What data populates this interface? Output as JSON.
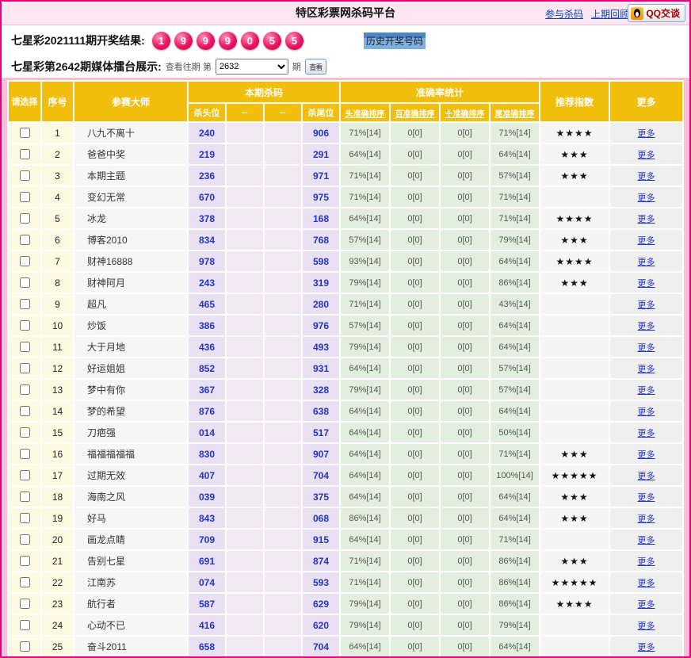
{
  "page": {
    "title": "特区彩票网杀码平台",
    "nav_links": [
      "参与杀码",
      "上期回顾"
    ],
    "qq_button": "QQ交谈"
  },
  "result": {
    "label": "七星彩2021111期开奖结果:",
    "balls": [
      "1",
      "9",
      "9",
      "9",
      "0",
      "5",
      "5"
    ],
    "history_link": "历史开奖号码"
  },
  "selector": {
    "label": "七星彩第2642期媒体擂台展示:",
    "hint": "查看往期 第",
    "period_value": "2632",
    "suffix": "期",
    "go_label": "查看"
  },
  "colors": {
    "accent_pink": "#E6007E",
    "header_gold": "#F1BE0C",
    "kill_number_blue": "#2233CC",
    "ball_red": "#EC1464"
  },
  "table": {
    "col_select": "请选择",
    "col_index": "序号",
    "col_master": "参赛大师",
    "group_kill": "本期杀码",
    "kill_subcols": [
      "杀头位",
      "--",
      "--",
      "杀尾位"
    ],
    "group_accuracy": "准确率统计",
    "accuracy_subcols": [
      "头准确排序",
      "百准确排序",
      "十准确排序",
      "尾准确排序"
    ],
    "col_stars": "推荐指数",
    "col_more": "更多",
    "more_label": "更多",
    "rows": [
      {
        "index": "1",
        "name": "八九不离十",
        "head": "240",
        "tail": "906",
        "acc": [
          "71%[14]",
          "0[0]",
          "0[0]",
          "71%[14]"
        ],
        "stars": "★★★★"
      },
      {
        "index": "2",
        "name": "爸爸中奖",
        "head": "219",
        "tail": "291",
        "acc": [
          "64%[14]",
          "0[0]",
          "0[0]",
          "64%[14]"
        ],
        "stars": "★★★"
      },
      {
        "index": "3",
        "name": "本期主题",
        "head": "236",
        "tail": "971",
        "acc": [
          "71%[14]",
          "0[0]",
          "0[0]",
          "57%[14]"
        ],
        "stars": "★★★"
      },
      {
        "index": "4",
        "name": "变幻无常",
        "head": "670",
        "tail": "975",
        "acc": [
          "71%[14]",
          "0[0]",
          "0[0]",
          "71%[14]"
        ],
        "stars": ""
      },
      {
        "index": "5",
        "name": "冰龙",
        "head": "378",
        "tail": "168",
        "acc": [
          "64%[14]",
          "0[0]",
          "0[0]",
          "71%[14]"
        ],
        "stars": "★★★★"
      },
      {
        "index": "6",
        "name": "博客2010",
        "head": "834",
        "tail": "768",
        "acc": [
          "57%[14]",
          "0[0]",
          "0[0]",
          "79%[14]"
        ],
        "stars": "★★★"
      },
      {
        "index": "7",
        "name": "财神16888",
        "head": "978",
        "tail": "598",
        "acc": [
          "93%[14]",
          "0[0]",
          "0[0]",
          "64%[14]"
        ],
        "stars": "★★★★"
      },
      {
        "index": "8",
        "name": "财神阿月",
        "head": "243",
        "tail": "319",
        "acc": [
          "79%[14]",
          "0[0]",
          "0[0]",
          "86%[14]"
        ],
        "stars": "★★★"
      },
      {
        "index": "9",
        "name": "超凡",
        "head": "465",
        "tail": "280",
        "acc": [
          "71%[14]",
          "0[0]",
          "0[0]",
          "43%[14]"
        ],
        "stars": ""
      },
      {
        "index": "10",
        "name": "炒饭",
        "head": "386",
        "tail": "976",
        "acc": [
          "57%[14]",
          "0[0]",
          "0[0]",
          "64%[14]"
        ],
        "stars": ""
      },
      {
        "index": "11",
        "name": "大于月地",
        "head": "436",
        "tail": "493",
        "acc": [
          "79%[14]",
          "0[0]",
          "0[0]",
          "64%[14]"
        ],
        "stars": ""
      },
      {
        "index": "12",
        "name": "好运姐姐",
        "head": "852",
        "tail": "931",
        "acc": [
          "64%[14]",
          "0[0]",
          "0[0]",
          "57%[14]"
        ],
        "stars": ""
      },
      {
        "index": "13",
        "name": "梦中有你",
        "head": "367",
        "tail": "328",
        "acc": [
          "79%[14]",
          "0[0]",
          "0[0]",
          "57%[14]"
        ],
        "stars": ""
      },
      {
        "index": "14",
        "name": "梦的希望",
        "head": "876",
        "tail": "638",
        "acc": [
          "64%[14]",
          "0[0]",
          "0[0]",
          "64%[14]"
        ],
        "stars": ""
      },
      {
        "index": "15",
        "name": "刀疤强",
        "head": "014",
        "tail": "517",
        "acc": [
          "64%[14]",
          "0[0]",
          "0[0]",
          "50%[14]"
        ],
        "stars": ""
      },
      {
        "index": "16",
        "name": "福福福福福",
        "head": "830",
        "tail": "907",
        "acc": [
          "64%[14]",
          "0[0]",
          "0[0]",
          "71%[14]"
        ],
        "stars": "★★★"
      },
      {
        "index": "17",
        "name": "过期无效",
        "head": "407",
        "tail": "704",
        "acc": [
          "64%[14]",
          "0[0]",
          "0[0]",
          "100%[14]"
        ],
        "stars": "★★★★★"
      },
      {
        "index": "18",
        "name": "海南之风",
        "head": "039",
        "tail": "375",
        "acc": [
          "64%[14]",
          "0[0]",
          "0[0]",
          "64%[14]"
        ],
        "stars": "★★★"
      },
      {
        "index": "19",
        "name": "好马",
        "head": "843",
        "tail": "068",
        "acc": [
          "86%[14]",
          "0[0]",
          "0[0]",
          "64%[14]"
        ],
        "stars": "★★★"
      },
      {
        "index": "20",
        "name": "画龙点睛",
        "head": "709",
        "tail": "915",
        "acc": [
          "64%[14]",
          "0[0]",
          "0[0]",
          "71%[14]"
        ],
        "stars": ""
      },
      {
        "index": "21",
        "name": "告别七星",
        "head": "691",
        "tail": "874",
        "acc": [
          "71%[14]",
          "0[0]",
          "0[0]",
          "86%[14]"
        ],
        "stars": "★★★"
      },
      {
        "index": "22",
        "name": "江南苏",
        "head": "074",
        "tail": "593",
        "acc": [
          "71%[14]",
          "0[0]",
          "0[0]",
          "86%[14]"
        ],
        "stars": "★★★★★"
      },
      {
        "index": "23",
        "name": "航行者",
        "head": "587",
        "tail": "629",
        "acc": [
          "79%[14]",
          "0[0]",
          "0[0]",
          "86%[14]"
        ],
        "stars": "★★★★"
      },
      {
        "index": "24",
        "name": "心动不已",
        "head": "416",
        "tail": "620",
        "acc": [
          "79%[14]",
          "0[0]",
          "0[0]",
          "79%[14]"
        ],
        "stars": ""
      },
      {
        "index": "25",
        "name": "奋斗2011",
        "head": "658",
        "tail": "704",
        "acc": [
          "64%[14]",
          "0[0]",
          "0[0]",
          "64%[14]"
        ],
        "stars": ""
      }
    ]
  }
}
